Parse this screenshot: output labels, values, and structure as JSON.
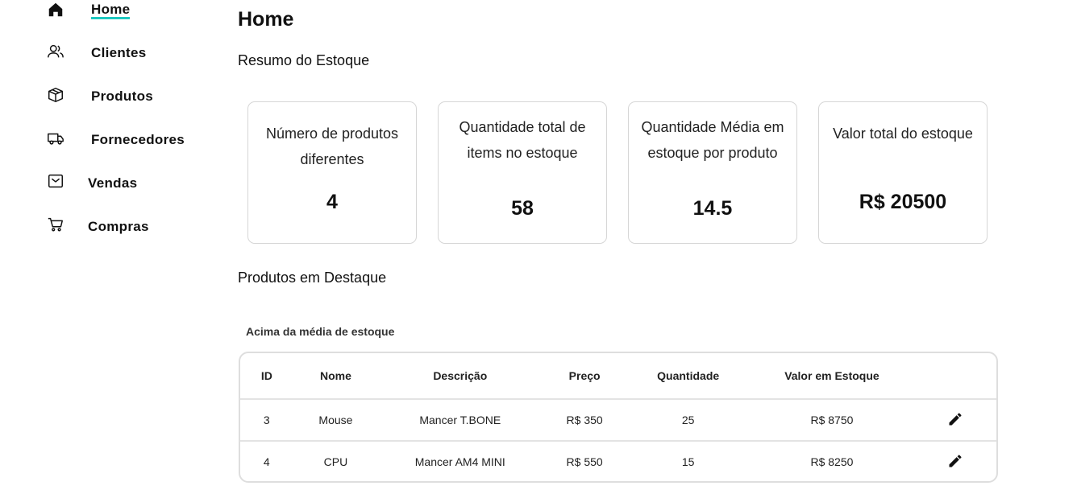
{
  "sidebar": {
    "items": [
      {
        "label": "Home",
        "icon": "home-icon",
        "active": true
      },
      {
        "label": "Clientes",
        "icon": "users-icon"
      },
      {
        "label": "Produtos",
        "icon": "box-icon"
      },
      {
        "label": "Fornecedores",
        "icon": "truck-icon"
      },
      {
        "label": "Vendas",
        "icon": "inbox-icon"
      },
      {
        "label": "Compras",
        "icon": "cart-icon"
      }
    ]
  },
  "page": {
    "title": "Home",
    "summary_title": "Resumo do Estoque",
    "featured_title": "Produtos em Destaque"
  },
  "cards": [
    {
      "label": "Número de produtos diferentes",
      "value": "4"
    },
    {
      "label": "Quantidade total de items no estoque",
      "value": "58"
    },
    {
      "label": "Quantidade Média em estoque por produto",
      "value": "14.5"
    },
    {
      "label": "Valor total do estoque",
      "value": "R$ 20500"
    }
  ],
  "table": {
    "caption": "Acima da média de estoque",
    "headers": [
      "ID",
      "Nome",
      "Descrição",
      "Preço",
      "Quantidade",
      "Valor em Estoque"
    ],
    "rows": [
      [
        "3",
        "Mouse",
        "Mancer T.BONE",
        "R$ 350",
        "25",
        "R$ 8750"
      ],
      [
        "4",
        "CPU",
        "Mancer AM4 MINI",
        "R$ 550",
        "15",
        "R$ 8250"
      ]
    ],
    "row_action_icon": "pencil-icon"
  },
  "colors": {
    "accent": "#1fc8c0",
    "border": "#d6d6d6"
  }
}
